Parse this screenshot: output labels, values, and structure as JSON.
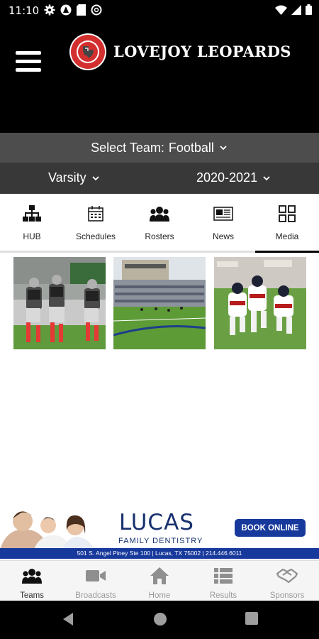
{
  "status_bar": {
    "time": "11:10"
  },
  "header": {
    "title": "LOVEJOY LEOPARDS"
  },
  "team_selector": {
    "label": "Select Team:",
    "value": "Football"
  },
  "filters": {
    "level": "Varsity",
    "season": "2020-2021"
  },
  "tabs": [
    {
      "label": "HUB",
      "icon": "hub-icon"
    },
    {
      "label": "Schedules",
      "icon": "calendar-icon"
    },
    {
      "label": "Rosters",
      "icon": "group-icon"
    },
    {
      "label": "News",
      "icon": "newspaper-icon"
    },
    {
      "label": "Media",
      "icon": "grid-icon",
      "active": true
    }
  ],
  "ad": {
    "brand": "LUCAS",
    "tagline": "FAMILY DENTISTRY",
    "cta": "BOOK ONLINE",
    "address": "501 S. Angel Piney Ste 100  |  Lucas, TX 75002  |  214.446.6011"
  },
  "bottom_nav": [
    {
      "label": "Teams",
      "icon": "teams-icon",
      "active": true
    },
    {
      "label": "Broadcasts",
      "icon": "video-camera-icon"
    },
    {
      "label": "Home",
      "icon": "home-icon"
    },
    {
      "label": "Results",
      "icon": "list-icon"
    },
    {
      "label": "Sponsors",
      "icon": "handshake-icon"
    }
  ],
  "colors": {
    "header_bg": "#000000",
    "team_bar_bg": "#4d4d4d",
    "filter_bar_bg": "#383838",
    "ad_blue": "#17399c",
    "brand_red": "#d32f2f"
  }
}
